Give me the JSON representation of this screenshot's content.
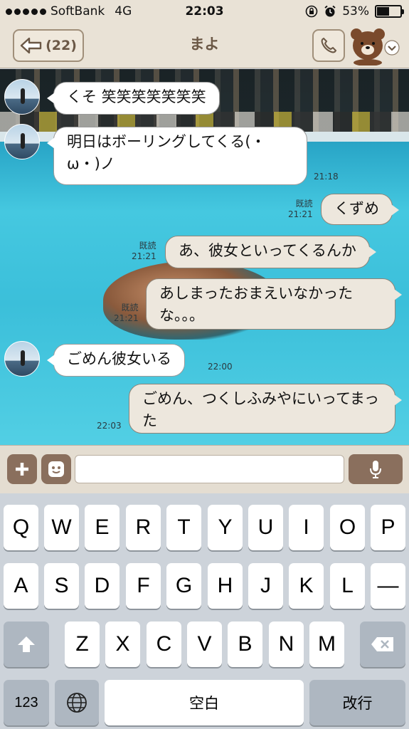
{
  "status": {
    "carrier": "SoftBank",
    "network": "4G",
    "time": "22:03",
    "battery": "53%",
    "battery_level": 0.53
  },
  "nav": {
    "back_count": "(22)",
    "title": "まよ"
  },
  "messages": [
    {
      "side": "in",
      "text": "くそ 笑笑笑笑笑笑笑"
    },
    {
      "side": "in",
      "text": "明日はボーリングしてくる(・ω・)ノ",
      "time": "21:18"
    },
    {
      "side": "out",
      "text": "くずめ",
      "read": "既読",
      "time": "21:21"
    },
    {
      "side": "out",
      "text": "あ、彼女といってくるんか",
      "read": "既読",
      "time": "21:21"
    },
    {
      "side": "out",
      "text": "あしまったおまえいなかったな。。。",
      "read": "既読",
      "time": "21:21"
    },
    {
      "side": "in",
      "text": "ごめん彼女いる",
      "time": "22:00"
    },
    {
      "side": "out",
      "text": "ごめん、つくしふみやにいってまった",
      "time": "22:03"
    }
  ],
  "input": {
    "placeholder": ""
  },
  "keyboard": {
    "row1": [
      "Q",
      "W",
      "E",
      "R",
      "T",
      "Y",
      "U",
      "I",
      "O",
      "P"
    ],
    "row2": [
      "A",
      "S",
      "D",
      "F",
      "G",
      "H",
      "J",
      "K",
      "L",
      "—"
    ],
    "row3": [
      "Z",
      "X",
      "C",
      "V",
      "B",
      "N",
      "M"
    ],
    "numbers_key": "123",
    "space_key": "空白",
    "return_key": "改行"
  },
  "colors": {
    "header_bg": "#e9e2d6",
    "brown_accent": "#8a6f5d",
    "outgoing_bubble": "#ede7dd",
    "incoming_bubble": "#ffffff"
  }
}
